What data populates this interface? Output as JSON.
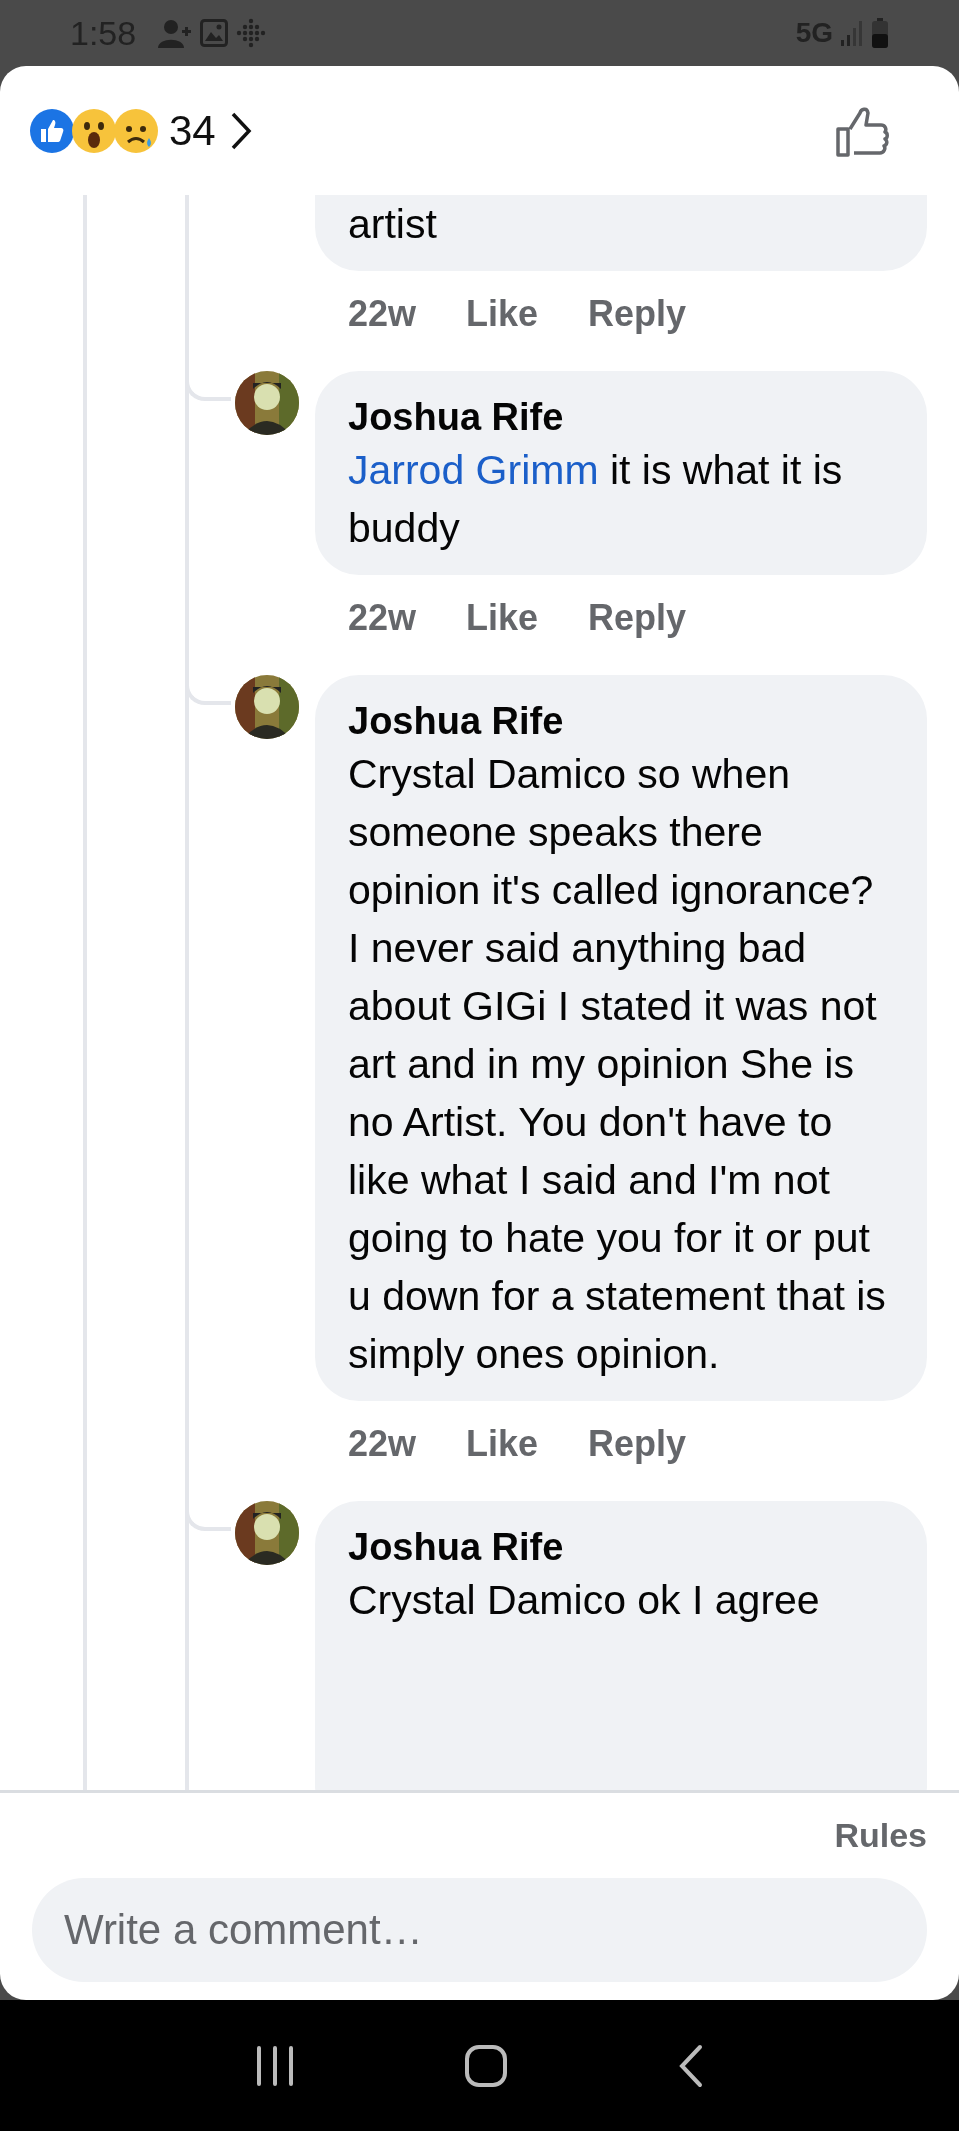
{
  "status_bar": {
    "time": "1:58",
    "network": "5G"
  },
  "reactions": {
    "count": "34"
  },
  "comments": [
    {
      "text": "artist",
      "time": "22w",
      "like": "Like",
      "reply": "Reply"
    },
    {
      "author": "Joshua Rife",
      "mention": "Jarrod Grimm",
      "text": " it is what it is buddy",
      "time": "22w",
      "like": "Like",
      "reply": "Reply"
    },
    {
      "author": "Joshua Rife",
      "text": "Crystal Damico so when someone speaks there opinion it's called ignorance? I never said anything bad about GIGi I stated it was not art and in my opinion She is no Artist. You don't have to like what I said and I'm not going to hate you for it or put u down for a statement that is simply ones opinion.",
      "time": "22w",
      "like": "Like",
      "reply": "Reply"
    },
    {
      "author": "Joshua Rife",
      "text": "Crystal Damico ok I agree"
    }
  ],
  "footer": {
    "rules": "Rules",
    "placeholder": "Write a comment…"
  }
}
